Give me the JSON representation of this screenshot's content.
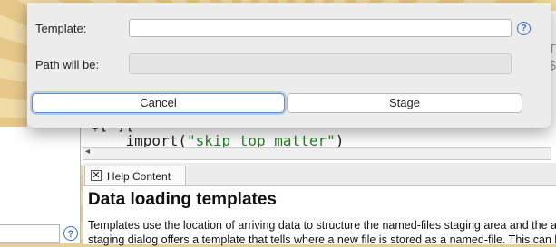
{
  "dialog": {
    "template_label": "Template:",
    "template_value": "",
    "path_label": "Path will be:",
    "path_value": "",
    "help_icon": "?",
    "cancel_label": "Cancel",
    "stage_label": "Stage"
  },
  "editor": {
    "code_line1": "$[*][",
    "code_line2_prefix": "    import(",
    "code_line2_string": "\"skip top matter\"",
    "code_line2_suffix": ")",
    "right_text1": "IT",
    "right_text2": "$"
  },
  "help_panel": {
    "tab_label": "Help Content",
    "title": "Data loading templates",
    "text_line1": "Templates use the location of arriving data to structure the named-files staging area and the arc",
    "text_line2": "staging dialog offers a template that tells where a new file is stored as a named-file. This can be"
  },
  "left_panel": {
    "help_icon": "?"
  },
  "colors": {
    "accent": "#3b6fc7",
    "code_string": "#2a7d2a"
  }
}
